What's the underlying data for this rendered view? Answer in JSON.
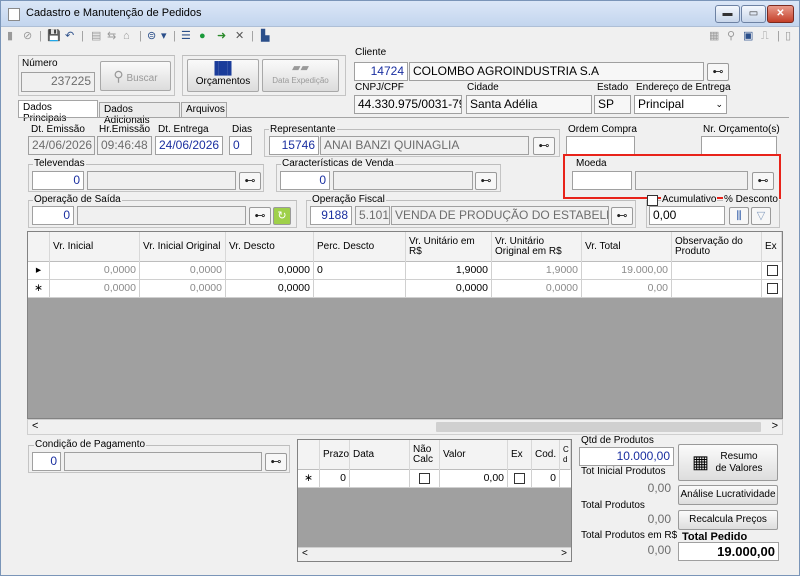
{
  "window": {
    "title": "Cadastro e Manutenção de Pedidos",
    "min": "▬",
    "max": "▭",
    "close": "✕"
  },
  "toolbar": {
    "left_icons": [
      "▮",
      "⊘",
      "|",
      "💾",
      "↶",
      "|",
      "▤",
      "⇆",
      "⌂",
      "|",
      "⊜",
      "▾",
      "|",
      "☰",
      "●",
      "➜",
      "✕",
      "|",
      "▙"
    ],
    "right_icons": [
      "▦",
      "⚲",
      "▣",
      "⎍",
      "|",
      "▯"
    ]
  },
  "numero": {
    "label": "Número",
    "value": "237225",
    "buscar": "Buscar"
  },
  "buttons": {
    "orcamentos": "Orçamentos",
    "data_expedicao": "Data Expedição"
  },
  "cliente": {
    "label": "Cliente",
    "code": "14724",
    "name": "COLOMBO AGROINDUSTRIA S.A",
    "cnpj_label": "CNPJ/CPF",
    "cnpj": "44.330.975/0031-79",
    "cidade_label": "Cidade",
    "cidade": "Santa Adélia",
    "estado_label": "Estado",
    "estado": "SP",
    "endereco_label": "Endereço de Entrega",
    "endereco": "Principal"
  },
  "tabs": [
    "Dados Principais",
    "Dados Adicionais",
    "Arquivos"
  ],
  "dates": {
    "emissao_label": "Dt. Emissão",
    "emissao": "24/06/2026",
    "hr_label": "Hr.Emissão",
    "hr": "09:46:48",
    "entrega_label": "Dt. Entrega",
    "entrega": "24/06/2026",
    "dias_label": "Dias",
    "dias": "0"
  },
  "representante": {
    "label": "Representante",
    "code": "15746",
    "name": "ANAI BANZI QUINAGLIA"
  },
  "ordem_compra": {
    "label": "Ordem Compra",
    "value": ""
  },
  "nr_orcamento": {
    "label": "Nr. Orçamento(s)",
    "value": ""
  },
  "televendas": {
    "label": "Televendas",
    "code": "0",
    "name": ""
  },
  "caracteristicas": {
    "label": "Características de Venda",
    "code": "0",
    "name": ""
  },
  "moeda": {
    "label": "Moeda",
    "code": "",
    "name": ""
  },
  "operacao_saida": {
    "label": "Operação de Saída",
    "code": "0",
    "name": ""
  },
  "operacao_fiscal": {
    "label": "Operação Fiscal",
    "code": "9188",
    "cfop": "5.101",
    "name": "VENDA DE PRODUÇÃO DO ESTABELE"
  },
  "acumulativo": {
    "label": "Acumulativo",
    "desconto_label": "% Desconto",
    "desconto": "0,00"
  },
  "grid": {
    "headers": [
      "Vr. Inicial",
      "Vr. Inicial Original",
      "Vr. Descto",
      "Perc. Descto",
      "Vr. Unitário em R$",
      "Vr. Unitário Original em R$",
      "Vr. Total",
      "Observação do Produto",
      "Ex"
    ],
    "rows": [
      {
        "marker": "▸",
        "vr_inicial": "0,0000",
        "vr_inicial_orig": "0,0000",
        "vr_descto": "0,0000",
        "perc": "0",
        "vr_unit": "1,9000",
        "vr_unit_orig": "1,9000",
        "vr_total": "19.000,00",
        "obs": ""
      },
      {
        "marker": "∗",
        "vr_inicial": "0,0000",
        "vr_inicial_orig": "0,0000",
        "vr_descto": "0,0000",
        "perc": "",
        "vr_unit": "0,0000",
        "vr_unit_orig": "0,0000",
        "vr_total": "0,00",
        "obs": ""
      }
    ]
  },
  "condicao": {
    "label": "Condição de Pagamento",
    "code": "0",
    "name": ""
  },
  "parcelas": {
    "headers": [
      "Prazo",
      "Data",
      "Não Calc",
      "Valor",
      "Ex",
      "Cod.",
      "C d"
    ],
    "row": {
      "marker": "∗",
      "prazo": "0",
      "data": "",
      "valor": "0,00",
      "cod": "0"
    }
  },
  "totais": {
    "qtd_label": "Qtd de Produtos",
    "qtd": "10.000,00",
    "tot_inicial_label": "Tot Inicial Produtos",
    "tot_inicial": "0,00",
    "total_produtos_label": "Total Produtos",
    "total_produtos": "0,00",
    "total_rs_label": "Total Produtos em R$",
    "total_rs": "0,00",
    "total_pedido_label": "Total Pedido",
    "total_pedido": "19.000,00"
  },
  "side_buttons": {
    "resumo": "Resumo de Valores",
    "analise": "Análise Lucratividade",
    "recalcula": "Recalcula Preços"
  },
  "scroll": {
    "left": "<",
    "right": ">"
  }
}
